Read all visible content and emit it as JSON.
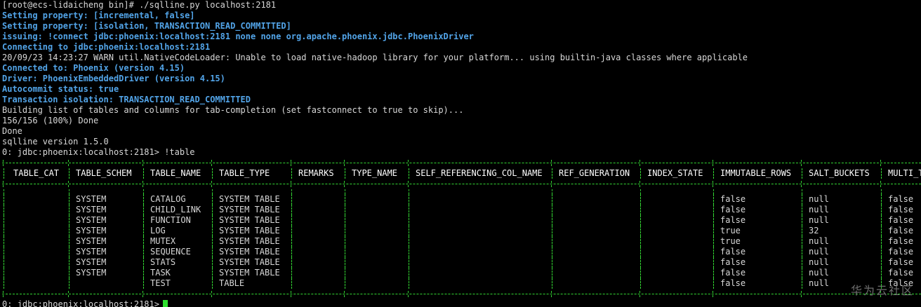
{
  "terminal": {
    "lines": [
      {
        "text": "[root@ecs-lidaicheng bin]# ./sqlline.py localhost:2181",
        "style": "normal"
      },
      {
        "text": "Setting property: [incremental, false]",
        "style": "info"
      },
      {
        "text": "Setting property: [isolation, TRANSACTION_READ_COMMITTED]",
        "style": "info"
      },
      {
        "text": "issuing: !connect jdbc:phoenix:localhost:2181 none none org.apache.phoenix.jdbc.PhoenixDriver",
        "style": "info"
      },
      {
        "text": "Connecting to jdbc:phoenix:localhost:2181",
        "style": "info"
      },
      {
        "text": "20/09/23 14:23:27 WARN util.NativeCodeLoader: Unable to load native-hadoop library for your platform... using builtin-java classes where applicable",
        "style": "normal"
      },
      {
        "text": "Connected to: Phoenix (version 4.15)",
        "style": "info"
      },
      {
        "text": "Driver: PhoenixEmbeddedDriver (version 4.15)",
        "style": "info"
      },
      {
        "text": "Autocommit status: true",
        "style": "info"
      },
      {
        "text": "Transaction isolation: TRANSACTION_READ_COMMITTED",
        "style": "info"
      },
      {
        "text": "Building list of tables and columns for tab-completion (set fastconnect to true to skip)...",
        "style": "normal"
      },
      {
        "text": "156/156 (100%) Done",
        "style": "normal"
      },
      {
        "text": "Done",
        "style": "normal"
      },
      {
        "text": "sqlline version 1.5.0",
        "style": "normal"
      },
      {
        "text": "0: jdbc:phoenix:localhost:2181> !table",
        "style": "normal"
      }
    ],
    "table": {
      "columns": [
        "TABLE_CAT",
        "TABLE_SCHEM",
        "TABLE_NAME",
        "TABLE_TYPE",
        "REMARKS",
        "TYPE_NAME",
        "SELF_REFERENCING_COL_NAME",
        "REF_GENERATION",
        "INDEX_STATE",
        "IMMUTABLE_ROWS",
        "SALT_BUCKETS",
        "MULTI_T"
      ],
      "rows": [
        [
          "",
          "SYSTEM",
          "CATALOG",
          "SYSTEM TABLE",
          "",
          "",
          "",
          "",
          "",
          "false",
          "null",
          "false"
        ],
        [
          "",
          "SYSTEM",
          "CHILD_LINK",
          "SYSTEM TABLE",
          "",
          "",
          "",
          "",
          "",
          "false",
          "null",
          "false"
        ],
        [
          "",
          "SYSTEM",
          "FUNCTION",
          "SYSTEM TABLE",
          "",
          "",
          "",
          "",
          "",
          "false",
          "null",
          "false"
        ],
        [
          "",
          "SYSTEM",
          "LOG",
          "SYSTEM TABLE",
          "",
          "",
          "",
          "",
          "",
          "true",
          "32",
          "false"
        ],
        [
          "",
          "SYSTEM",
          "MUTEX",
          "SYSTEM TABLE",
          "",
          "",
          "",
          "",
          "",
          "true",
          "null",
          "false"
        ],
        [
          "",
          "SYSTEM",
          "SEQUENCE",
          "SYSTEM TABLE",
          "",
          "",
          "",
          "",
          "",
          "false",
          "null",
          "false"
        ],
        [
          "",
          "SYSTEM",
          "STATS",
          "SYSTEM TABLE",
          "",
          "",
          "",
          "",
          "",
          "false",
          "null",
          "false"
        ],
        [
          "",
          "SYSTEM",
          "TASK",
          "SYSTEM TABLE",
          "",
          "",
          "",
          "",
          "",
          "false",
          "null",
          "false"
        ],
        [
          "",
          "",
          "TEST",
          "TABLE",
          "",
          "",
          "",
          "",
          "",
          "false",
          "null",
          "false"
        ]
      ]
    },
    "final_prompt": "0: jdbc:phoenix:localhost:2181>",
    "cursor_icon": "block-cursor-icon"
  },
  "watermark": "华为云社区",
  "colors": {
    "background": "#000000",
    "text": "#d8d8d8",
    "info_text": "#52a4e8",
    "table_border": "#33d633",
    "cursor": "#2ee02e",
    "watermark": "#6f6f6f"
  }
}
